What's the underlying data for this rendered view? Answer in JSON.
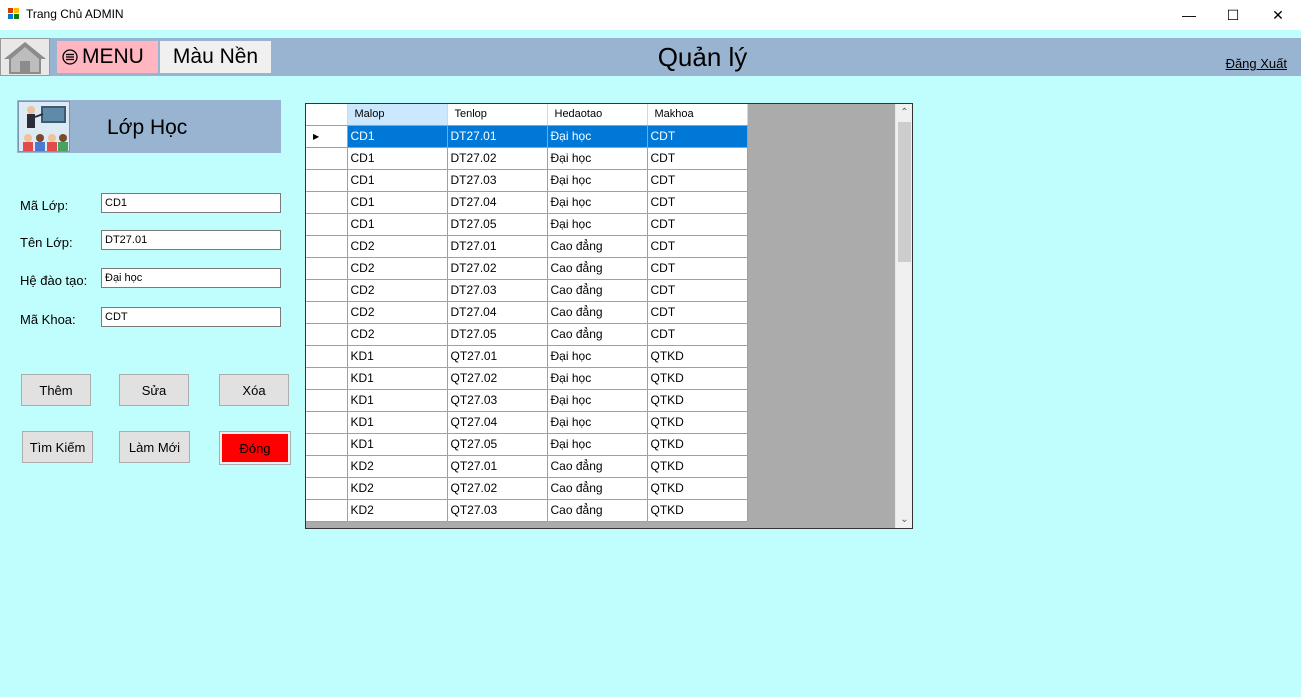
{
  "window": {
    "title": "Trang Chủ ADMIN",
    "minimize": "—",
    "maximize": "☐",
    "close": "✕"
  },
  "header": {
    "menu_label": "MENU",
    "color_label": "Màu Nền",
    "page_title": "Quản lý",
    "logout": "Đăng Xuất"
  },
  "section": {
    "title": "Lớp Học"
  },
  "form": {
    "ma_lop": {
      "label": "Mã Lớp:",
      "value": "CD1"
    },
    "ten_lop": {
      "label": "Tên Lớp:",
      "value": "DT27.01"
    },
    "he_dao_tao": {
      "label": "Hệ đào tạo:",
      "value": "Đại học"
    },
    "ma_khoa": {
      "label": "Mã Khoa:",
      "value": "CDT"
    }
  },
  "buttons": {
    "them": "Thêm",
    "sua": "Sửa",
    "xoa": "Xóa",
    "tim_kiem": "Tìm Kiếm",
    "lam_moi": "Làm Mới",
    "dong": "Đóng"
  },
  "grid": {
    "columns": [
      "Malop",
      "Tenlop",
      "Hedaotao",
      "Makhoa"
    ],
    "rows": [
      [
        "CD1",
        "DT27.01",
        "Đại học",
        "CDT"
      ],
      [
        "CD1",
        "DT27.02",
        "Đại học",
        "CDT"
      ],
      [
        "CD1",
        "DT27.03",
        "Đại học",
        "CDT"
      ],
      [
        "CD1",
        "DT27.04",
        "Đại học",
        "CDT"
      ],
      [
        "CD1",
        "DT27.05",
        "Đại học",
        "CDT"
      ],
      [
        "CD2",
        "DT27.01",
        "Cao đẳng",
        "CDT"
      ],
      [
        "CD2",
        "DT27.02",
        "Cao đẳng",
        "CDT"
      ],
      [
        "CD2",
        "DT27.03",
        "Cao đẳng",
        "CDT"
      ],
      [
        "CD2",
        "DT27.04",
        "Cao đẳng",
        "CDT"
      ],
      [
        "CD2",
        "DT27.05",
        "Cao đẳng",
        "CDT"
      ],
      [
        "KD1",
        "QT27.01",
        "Đại học",
        "QTKD"
      ],
      [
        "KD1",
        "QT27.02",
        "Đại học",
        "QTKD"
      ],
      [
        "KD1",
        "QT27.03",
        "Đại học",
        "QTKD"
      ],
      [
        "KD1",
        "QT27.04",
        "Đại học",
        "QTKD"
      ],
      [
        "KD1",
        "QT27.05",
        "Đại học",
        "QTKD"
      ],
      [
        "KD2",
        "QT27.01",
        "Cao đẳng",
        "QTKD"
      ],
      [
        "KD2",
        "QT27.02",
        "Cao đẳng",
        "QTKD"
      ],
      [
        "KD2",
        "QT27.03",
        "Cao đẳng",
        "QTKD"
      ]
    ],
    "selected_row": 0,
    "row_marker": "▶"
  },
  "colors": {
    "background": "#c0fdfd",
    "header": "#99b4d1",
    "selection": "#0078d7",
    "menu": "#ffb6c1",
    "close_button": "#ff0000"
  },
  "icons": [
    "app-icon",
    "home-icon",
    "menu-icon",
    "classroom-icon",
    "scroll-up-icon",
    "scroll-down-icon"
  ]
}
